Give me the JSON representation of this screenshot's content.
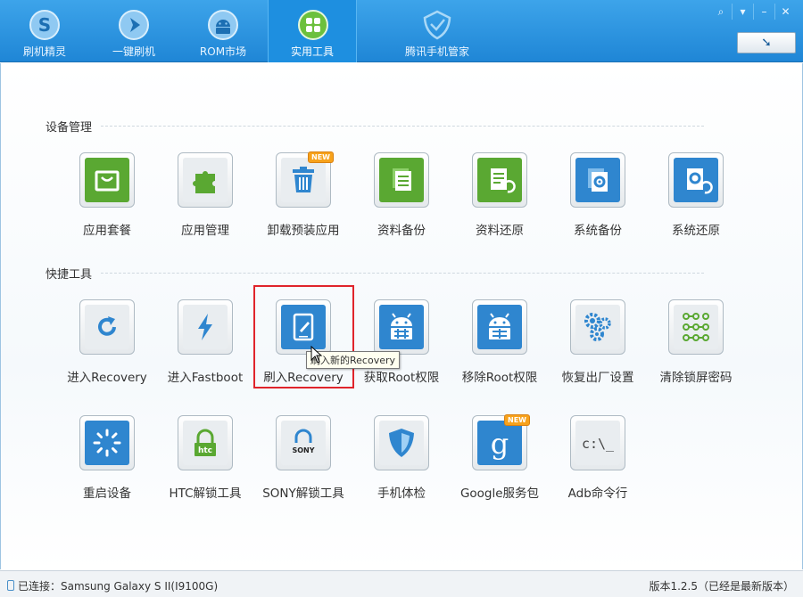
{
  "tabs": [
    {
      "label": "刷机精灵",
      "icon": "flash-sprite-logo-icon"
    },
    {
      "label": "一键刷机",
      "icon": "play-arrow-icon"
    },
    {
      "label": "ROM市场",
      "icon": "android-icon"
    },
    {
      "label": "实用工具",
      "icon": "grid-tools-icon",
      "active": true
    },
    {
      "label": "腾讯手机管家",
      "icon": "shield-check-icon"
    }
  ],
  "window_buttons": {
    "feedback": "⌕",
    "menu": "▾",
    "minimize": "–",
    "close": "✕"
  },
  "update_button": "➘",
  "sections": {
    "device": {
      "title": "设备管理",
      "items": [
        {
          "label": "应用套餐",
          "icon": "shopping-bag-icon"
        },
        {
          "label": "应用管理",
          "icon": "puzzle-icon"
        },
        {
          "label": "卸载预装应用",
          "icon": "trash-icon",
          "badge": "NEW"
        },
        {
          "label": "资料备份",
          "icon": "document-backup-icon"
        },
        {
          "label": "资料还原",
          "icon": "document-restore-icon"
        },
        {
          "label": "系统备份",
          "icon": "system-backup-icon"
        },
        {
          "label": "系统还原",
          "icon": "system-restore-icon"
        }
      ]
    },
    "quick": {
      "title": "快捷工具",
      "items": [
        {
          "label": "进入Recovery",
          "icon": "refresh-icon"
        },
        {
          "label": "进入Fastboot",
          "icon": "lightning-icon"
        },
        {
          "label": "刷入Recovery",
          "icon": "tablet-edit-icon"
        },
        {
          "label": "获取Root权限",
          "icon": "android-root-icon"
        },
        {
          "label": "移除Root权限",
          "icon": "android-unroot-icon"
        },
        {
          "label": "恢复出厂设置",
          "icon": "gears-icon"
        },
        {
          "label": "清除锁屏密码",
          "icon": "pattern-lock-icon"
        },
        {
          "label": "重启设备",
          "icon": "restart-sun-icon"
        },
        {
          "label": "HTC解锁工具",
          "icon": "htc-lock-icon",
          "brand": "htc"
        },
        {
          "label": "SONY解锁工具",
          "icon": "sony-lock-icon",
          "brand": "SONY"
        },
        {
          "label": "手机体检",
          "icon": "shield-icon"
        },
        {
          "label": "Google服务包",
          "icon": "google-g-icon",
          "badge": "NEW"
        },
        {
          "label": "Adb命令行",
          "icon": "terminal-icon",
          "prompt": "c:\\_"
        }
      ]
    }
  },
  "tooltip": "刷入新的Recovery",
  "status": {
    "connection": "已连接：Samsung Galaxy S II(I9100G)",
    "version": "版本1.2.5（已经是最新版本）"
  },
  "colors": {
    "topbar": "#2b93e0",
    "green_tile": "#5aa832",
    "blue_tile": "#2f86cf",
    "highlight": "#e0242b",
    "new_badge": "#f7a21b"
  }
}
